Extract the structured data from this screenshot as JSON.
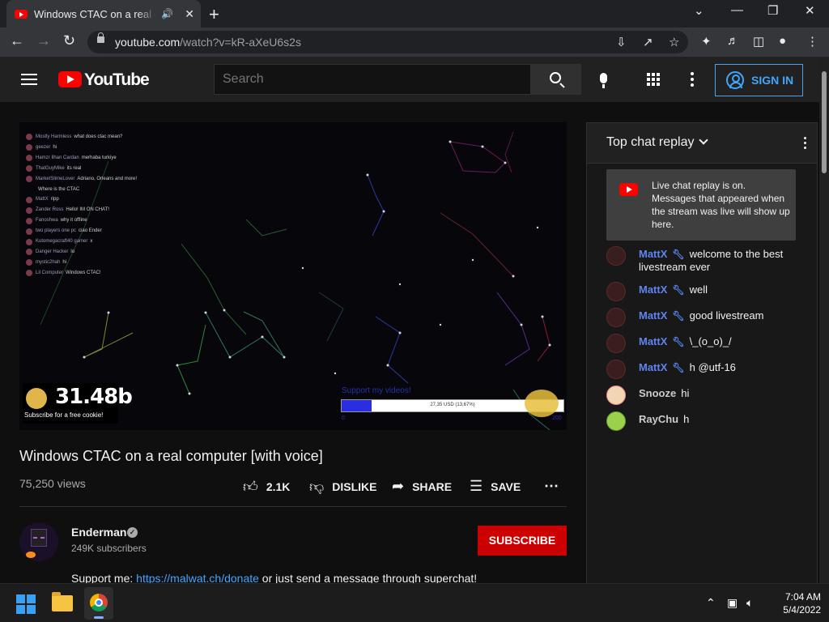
{
  "browser": {
    "tab_title": "Windows CTAC on a real computer [with voice]",
    "url_host": "youtube.com",
    "url_path": "/watch?v=kR-aXeU6s2s"
  },
  "youtube": {
    "logo_text": "YouTube",
    "search_placeholder": "Search",
    "sign_in": "SIGN IN"
  },
  "video": {
    "title": "Windows CTAC on a real computer [with voice]",
    "views": "75,250 views",
    "likes": "2.1K",
    "dislike_label": "DISLIKE",
    "share_label": "SHARE",
    "save_label": "SAVE",
    "overlay": {
      "cookie_count": "31.48b",
      "cookie_caption": "Subscribe for a free cookie!",
      "support_label": "Support my videos!",
      "progress_text": "27,35 USD (13,67%)",
      "progress_fraction": 0.1367,
      "progress_min": "0",
      "progress_max": "200",
      "chat_lines": [
        {
          "name": "Mostly Harmless",
          "text": "what does ctac mean?"
        },
        {
          "name": "geezer",
          "text": "hi"
        },
        {
          "name": "Hamzr Ilhan Cardan",
          "text": "merhaba turkiye"
        },
        {
          "name": "ThatGuyMike",
          "text": "its real"
        },
        {
          "name": "MarketSlimeLover",
          "text": "Adriano, Orleans and more!"
        },
        {
          "name": "",
          "text": "Where is the CTAC"
        },
        {
          "name": "MattX",
          "text": "ripp"
        },
        {
          "name": "Zander Ross",
          "text": "Hello! IM ON CHAT!"
        },
        {
          "name": "Fanoshwa",
          "text": "why it offline"
        },
        {
          "name": "two players one pc",
          "text": "ciao Ender"
        },
        {
          "name": "Kutomegacraft40 gamer",
          "text": "x"
        },
        {
          "name": "Danger Hacker",
          "text": "lo"
        },
        {
          "name": "mystic2hah",
          "text": "hi"
        },
        {
          "name": "Lil Computer",
          "text": "Windows CTAC!"
        }
      ]
    }
  },
  "channel": {
    "name": "Enderman",
    "subscribers": "249K subscribers",
    "subscribe_label": "SUBSCRIBE",
    "description_prefix": "Support me: ",
    "description_link": "https://malwat.ch/donate",
    "description_suffix": " or just send a message through superchat!"
  },
  "chat": {
    "header": "Top chat replay",
    "banner": "Live chat replay is on. Messages that appeared when the stream was live will show up here.",
    "messages": [
      {
        "author": "MattX",
        "moderator": true,
        "text": "welcome to the best livestream ever"
      },
      {
        "author": "MattX",
        "moderator": true,
        "text": "well"
      },
      {
        "author": "MattX",
        "moderator": true,
        "text": "good livestream"
      },
      {
        "author": "MattX",
        "moderator": true,
        "text": "\\_(o_o)_/"
      },
      {
        "author": "MattX",
        "moderator": true,
        "text": "h @utf-16"
      },
      {
        "author": "Snooze",
        "moderator": false,
        "text": "hi"
      },
      {
        "author": "RayChu",
        "moderator": false,
        "text": "h"
      }
    ]
  },
  "taskbar": {
    "time": "7:04 AM",
    "date": "5/4/2022"
  },
  "colors": {
    "accent_blue": "#3ea6ff",
    "brand_red": "#ff0000",
    "subscribe_red": "#cc0000",
    "moderator_blue": "#5e84f1"
  }
}
